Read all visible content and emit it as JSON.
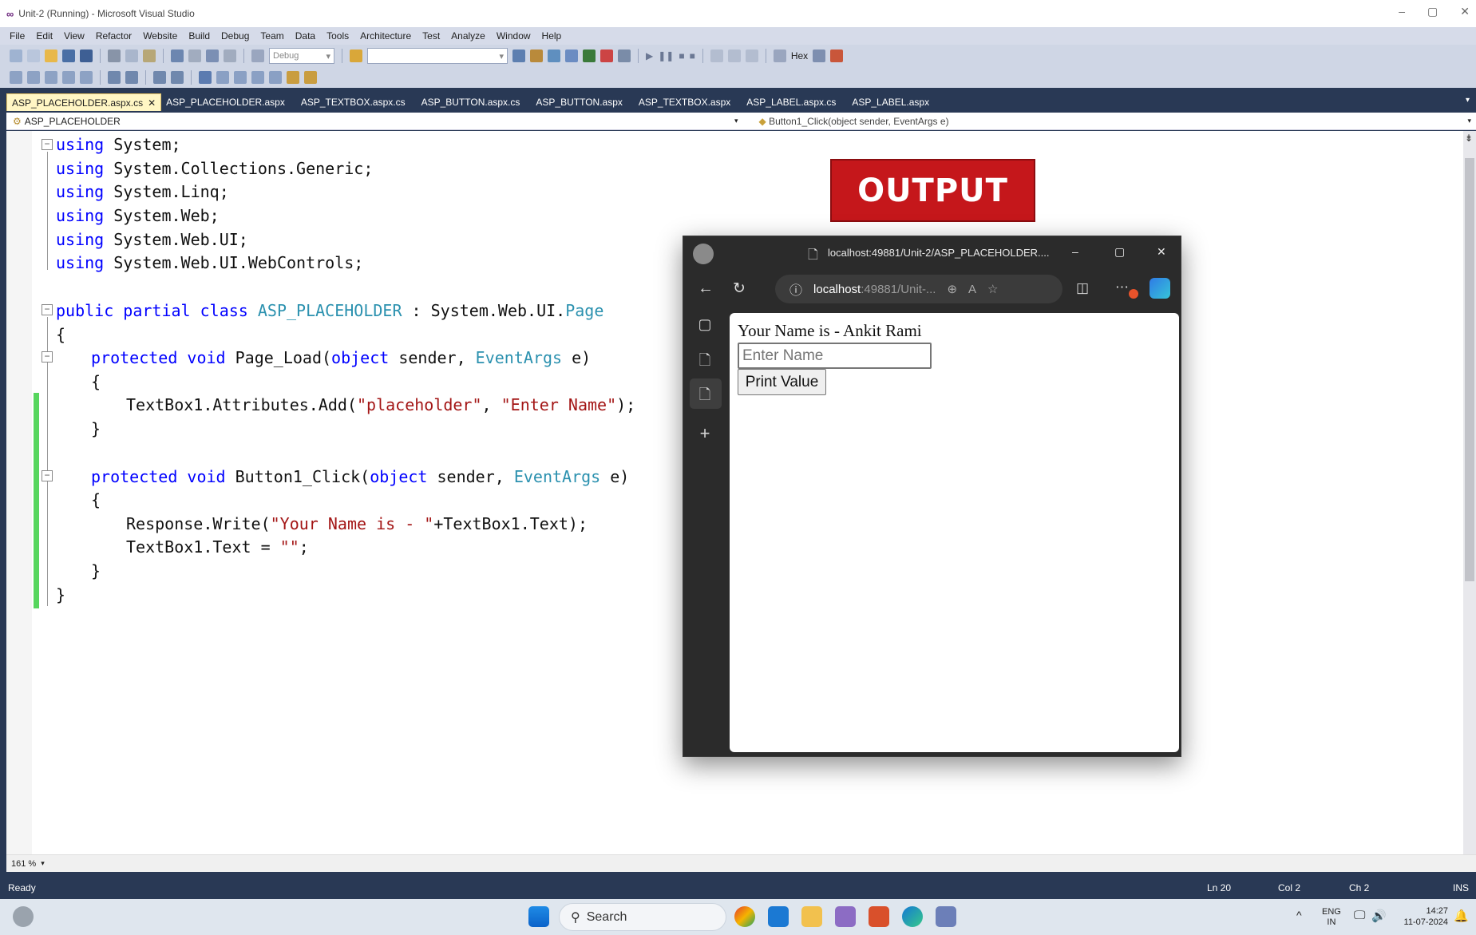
{
  "window": {
    "title": "Unit-2 (Running) - Microsoft Visual Studio",
    "controls": [
      "–",
      "▢",
      "✕"
    ]
  },
  "menu": [
    "File",
    "Edit",
    "View",
    "Refactor",
    "Website",
    "Build",
    "Debug",
    "Team",
    "Data",
    "Tools",
    "Architecture",
    "Test",
    "Analyze",
    "Window",
    "Help"
  ],
  "toolbar": {
    "config": "Debug",
    "hex_label": "Hex"
  },
  "tabs": [
    {
      "label": "ASP_PLACEHOLDER.aspx.cs",
      "active": true
    },
    {
      "label": "ASP_PLACEHOLDER.aspx"
    },
    {
      "label": "ASP_TEXTBOX.aspx.cs"
    },
    {
      "label": "ASP_BUTTON.aspx.cs"
    },
    {
      "label": "ASP_BUTTON.aspx"
    },
    {
      "label": "ASP_TEXTBOX.aspx"
    },
    {
      "label": "ASP_LABEL.aspx.cs"
    },
    {
      "label": "ASP_LABEL.aspx"
    }
  ],
  "navbar": {
    "class_name": "ASP_PLACEHOLDER",
    "member": "Button1_Click(object sender, EventArgs e)"
  },
  "code": {
    "l1": "using System;",
    "l2": "using System.Collections.Generic;",
    "l3": "using System.Linq;",
    "l4": "using System.Web;",
    "l5": "using System.Web.UI;",
    "l6": "using System.Web.UI.WebControls;",
    "l8a": "public partial class ",
    "l8b": "ASP_PLACEHOLDER",
    "l8c": " : System.Web.UI.",
    "l8d": "Page",
    "l9": "{",
    "l10a": "protected void ",
    "l10b": "Page_Load(",
    "l10c": "object",
    "l10d": " sender, ",
    "l10e": "EventArgs",
    "l10f": " e)",
    "l11": "{",
    "l12a": "TextBox1.Attributes.Add(",
    "l12b": "\"placeholder\"",
    "l12c": ", ",
    "l12d": "\"Enter Name\"",
    "l12e": ");",
    "l13": "}",
    "l15a": "protected void ",
    "l15b": "Button1_Click(",
    "l15c": "object",
    "l15d": " sender, ",
    "l15e": "EventArgs",
    "l15f": " e)",
    "l16": "{",
    "l17a": "Response.Write(",
    "l17b": "\"Your Name is - \"",
    "l17c": "+TextBox1.Text);",
    "l18a": "TextBox1.Text = ",
    "l18b": "\"\"",
    "l18c": ";",
    "l19": "}",
    "l20": "}"
  },
  "zoom": "161 %",
  "status": {
    "ready": "Ready",
    "ln": "Ln 20",
    "col": "Col 2",
    "ch": "Ch 2",
    "ins": "INS"
  },
  "output_label": "OUTPUT",
  "browser": {
    "tab_title": "localhost:49881/Unit-2/ASP_PLACEHOLDER....",
    "address_host": "localhost",
    "address_rest": ":49881/Unit-...",
    "page_text": "Your Name is - Ankit Rami",
    "input_placeholder": "Enter Name",
    "button_label": "Print Value"
  },
  "taskbar": {
    "search": "Search",
    "lang": "ENG",
    "region": "IN",
    "time": "14:27",
    "date": "11-07-2024"
  }
}
